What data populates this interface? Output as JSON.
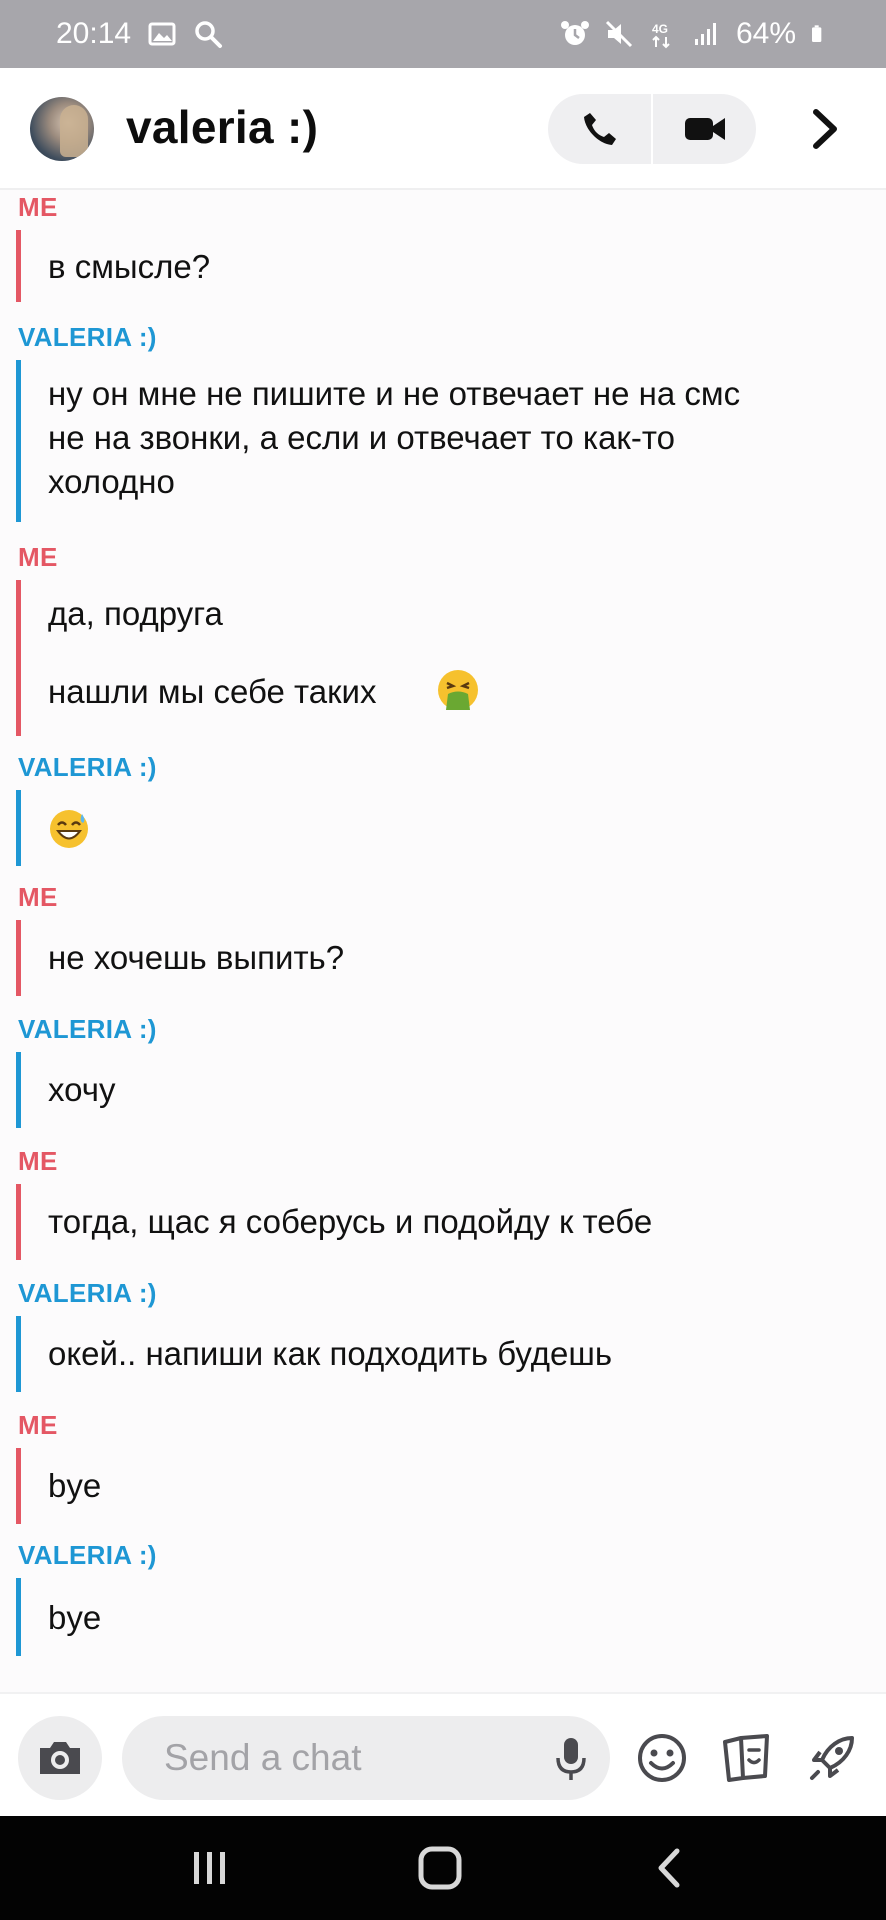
{
  "status_bar": {
    "time": "20:14",
    "battery": "64%",
    "network": "4G"
  },
  "header": {
    "contact_name": "valeria :)"
  },
  "messages": [
    {
      "sender": "ME",
      "lines": [
        "в смысле?"
      ]
    },
    {
      "sender": "VALERIA :)",
      "lines": [
        "ну он мне не пишите и не отвечает не на смс",
        "не на звонки, а если и отвечает то как-то",
        "холодно"
      ]
    },
    {
      "sender": "ME",
      "lines": [
        "да, подруга",
        "нашли мы себе таких"
      ],
      "emoji": "vomiting-face-emoji"
    },
    {
      "sender": "VALERIA :)",
      "lines": [],
      "emoji": "grinning-sweat-emoji"
    },
    {
      "sender": "ME",
      "lines": [
        "не хочешь выпить?"
      ]
    },
    {
      "sender": "VALERIA :)",
      "lines": [
        "хочу"
      ]
    },
    {
      "sender": "ME",
      "lines": [
        "тогда, щас я соберусь и подойду к тебе"
      ]
    },
    {
      "sender": "VALERIA :)",
      "lines": [
        "окей.. напиши как подходить будешь"
      ]
    },
    {
      "sender": "ME",
      "lines": [
        "bye"
      ]
    },
    {
      "sender": "VALERIA :)",
      "lines": [
        "bye"
      ]
    }
  ],
  "composer": {
    "placeholder": "Send a chat"
  },
  "colors": {
    "me": "#e45764",
    "valeria": "#1e97d4",
    "status_bar": "#a7a6ab",
    "nav_bar": "#030303"
  },
  "icons": {
    "status_left": [
      "gallery-icon",
      "search-icon"
    ],
    "status_right": [
      "alarm-icon",
      "mute-icon",
      "network-4g-icon",
      "signal-icon",
      "battery-icon"
    ],
    "header": [
      "phone-icon",
      "video-camera-icon",
      "chevron-right-icon"
    ],
    "composer": [
      "camera-icon",
      "microphone-icon",
      "smiley-icon",
      "stickers-icon",
      "rocket-icon"
    ],
    "nav": [
      "recents-icon",
      "home-icon",
      "back-icon"
    ]
  }
}
